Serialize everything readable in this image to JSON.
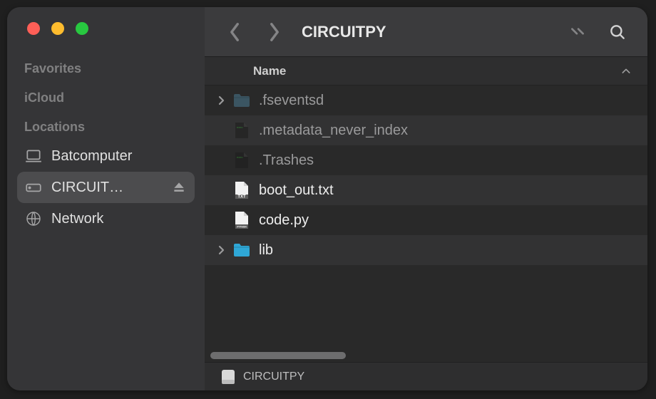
{
  "window": {
    "title": "CIRCUITPY",
    "traffic_lights": {
      "close": "#FF5F57",
      "min": "#FEBC2E",
      "max": "#28C840"
    }
  },
  "sidebar": {
    "sections": [
      {
        "label": "Favorites",
        "items": []
      },
      {
        "label": "iCloud",
        "items": []
      },
      {
        "label": "Locations",
        "items": [
          {
            "icon": "laptop-icon",
            "name": "Batcomputer",
            "selected": false,
            "ejectable": false
          },
          {
            "icon": "drive-icon",
            "name": "CIRCUIT…",
            "selected": true,
            "ejectable": true
          },
          {
            "icon": "globe-icon",
            "name": "Network",
            "selected": false,
            "ejectable": false
          }
        ]
      }
    ]
  },
  "columns": {
    "name": "Name",
    "sort": "ascending"
  },
  "files": [
    {
      "name": ".fseventsd",
      "type": "folder",
      "hidden": true,
      "expandable": true
    },
    {
      "name": ".metadata_never_index",
      "type": "execdoc",
      "hidden": true,
      "expandable": false
    },
    {
      "name": ".Trashes",
      "type": "execdoc",
      "hidden": true,
      "expandable": false
    },
    {
      "name": "boot_out.txt",
      "type": "txt",
      "hidden": false,
      "expandable": false
    },
    {
      "name": "code.py",
      "type": "py",
      "hidden": false,
      "expandable": false
    },
    {
      "name": "lib",
      "type": "folder",
      "hidden": false,
      "expandable": true
    }
  ],
  "pathbar": {
    "drive": "CIRCUITPY"
  }
}
